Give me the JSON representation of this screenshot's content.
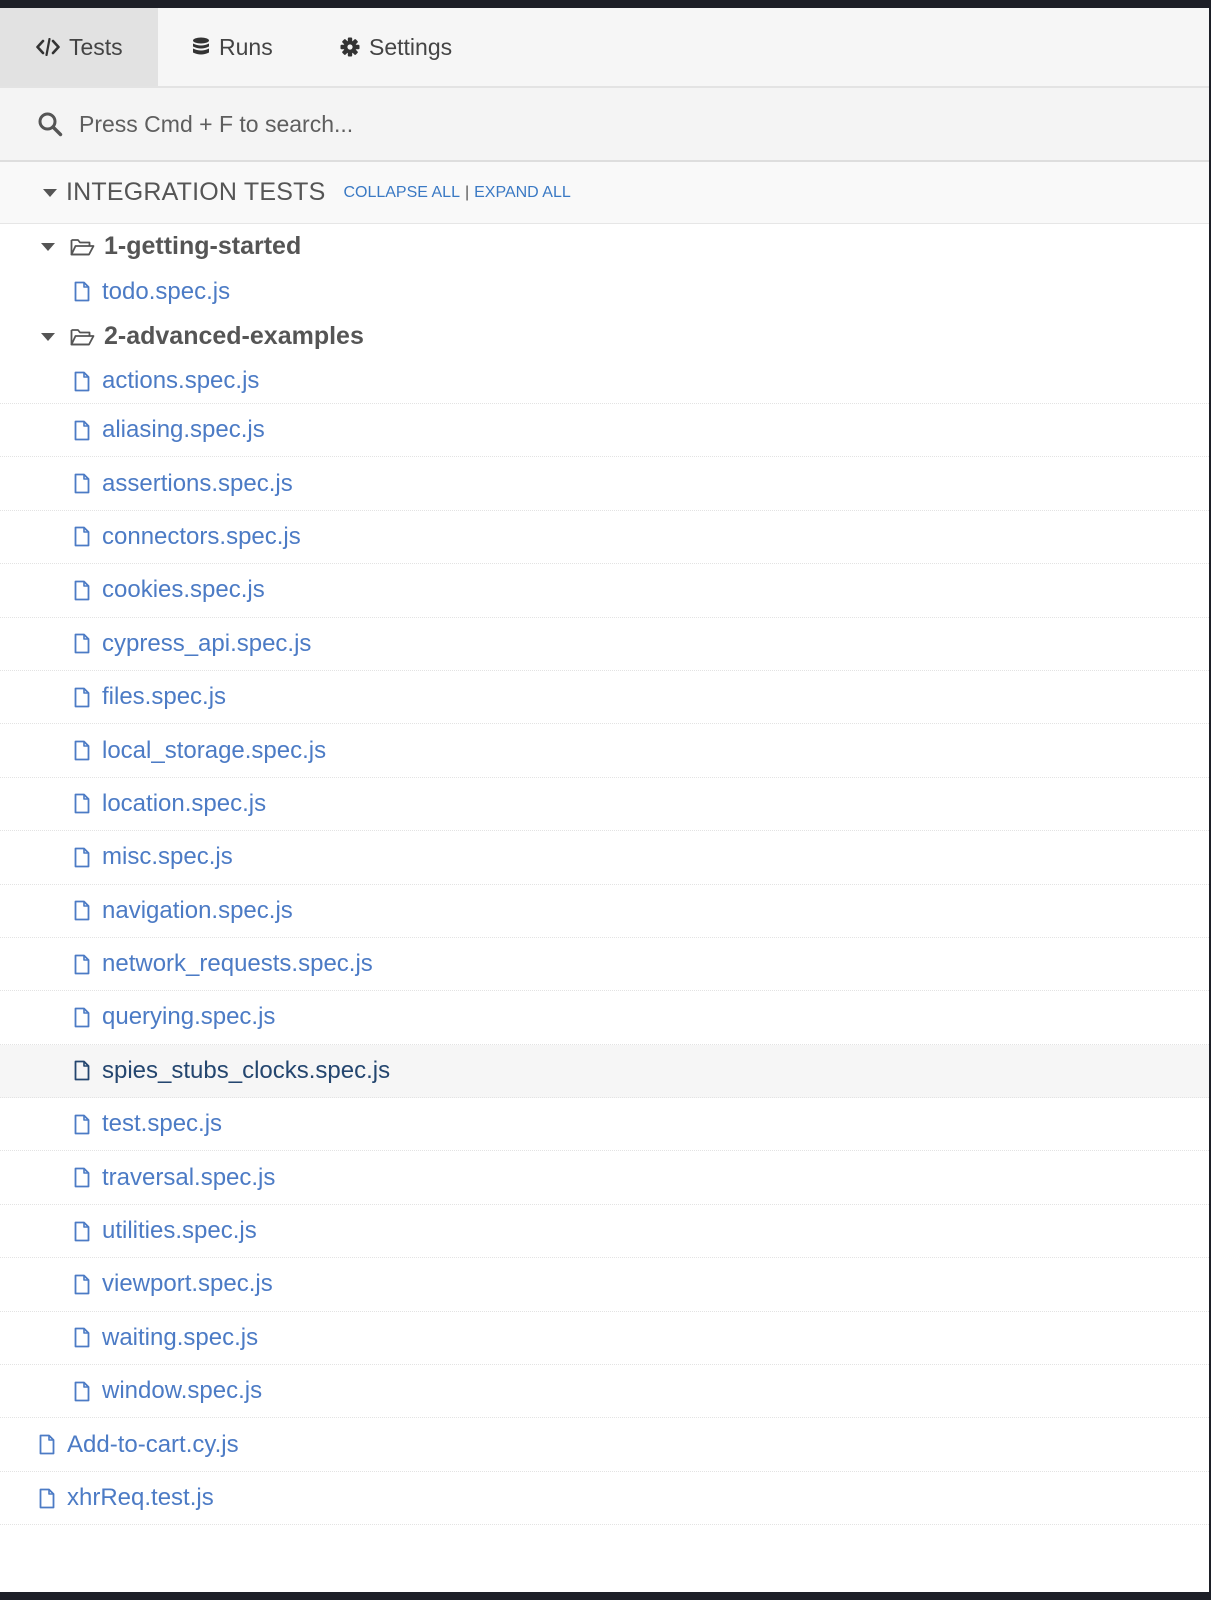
{
  "nav": {
    "tabs": [
      {
        "label": "Tests",
        "icon": "code-icon",
        "active": true
      },
      {
        "label": "Runs",
        "icon": "database-icon",
        "active": false
      },
      {
        "label": "Settings",
        "icon": "gear-icon",
        "active": false
      }
    ]
  },
  "search": {
    "placeholder": "Press Cmd + F to search...",
    "value": ""
  },
  "section": {
    "title": "INTEGRATION TESTS",
    "collapse_all": "COLLAPSE ALL",
    "separator": "|",
    "expand_all": "EXPAND ALL"
  },
  "folders": [
    {
      "name": "1-getting-started",
      "files": [
        "todo.spec.js"
      ]
    },
    {
      "name": "2-advanced-examples",
      "files": [
        "actions.spec.js",
        "aliasing.spec.js",
        "assertions.spec.js",
        "connectors.spec.js",
        "cookies.spec.js",
        "cypress_api.spec.js",
        "files.spec.js",
        "local_storage.spec.js",
        "location.spec.js",
        "misc.spec.js",
        "navigation.spec.js",
        "network_requests.spec.js",
        "querying.spec.js",
        "spies_stubs_clocks.spec.js",
        "test.spec.js",
        "traversal.spec.js",
        "utilities.spec.js",
        "viewport.spec.js",
        "waiting.spec.js",
        "window.spec.js"
      ]
    }
  ],
  "root_files": [
    "Add-to-cart.cy.js",
    "xhrReq.test.js"
  ],
  "selected_file": "spies_stubs_clocks.spec.js",
  "colors": {
    "link": "#4c7bc5",
    "selected_link": "#24466f",
    "accent_link": "#3a79c4"
  }
}
